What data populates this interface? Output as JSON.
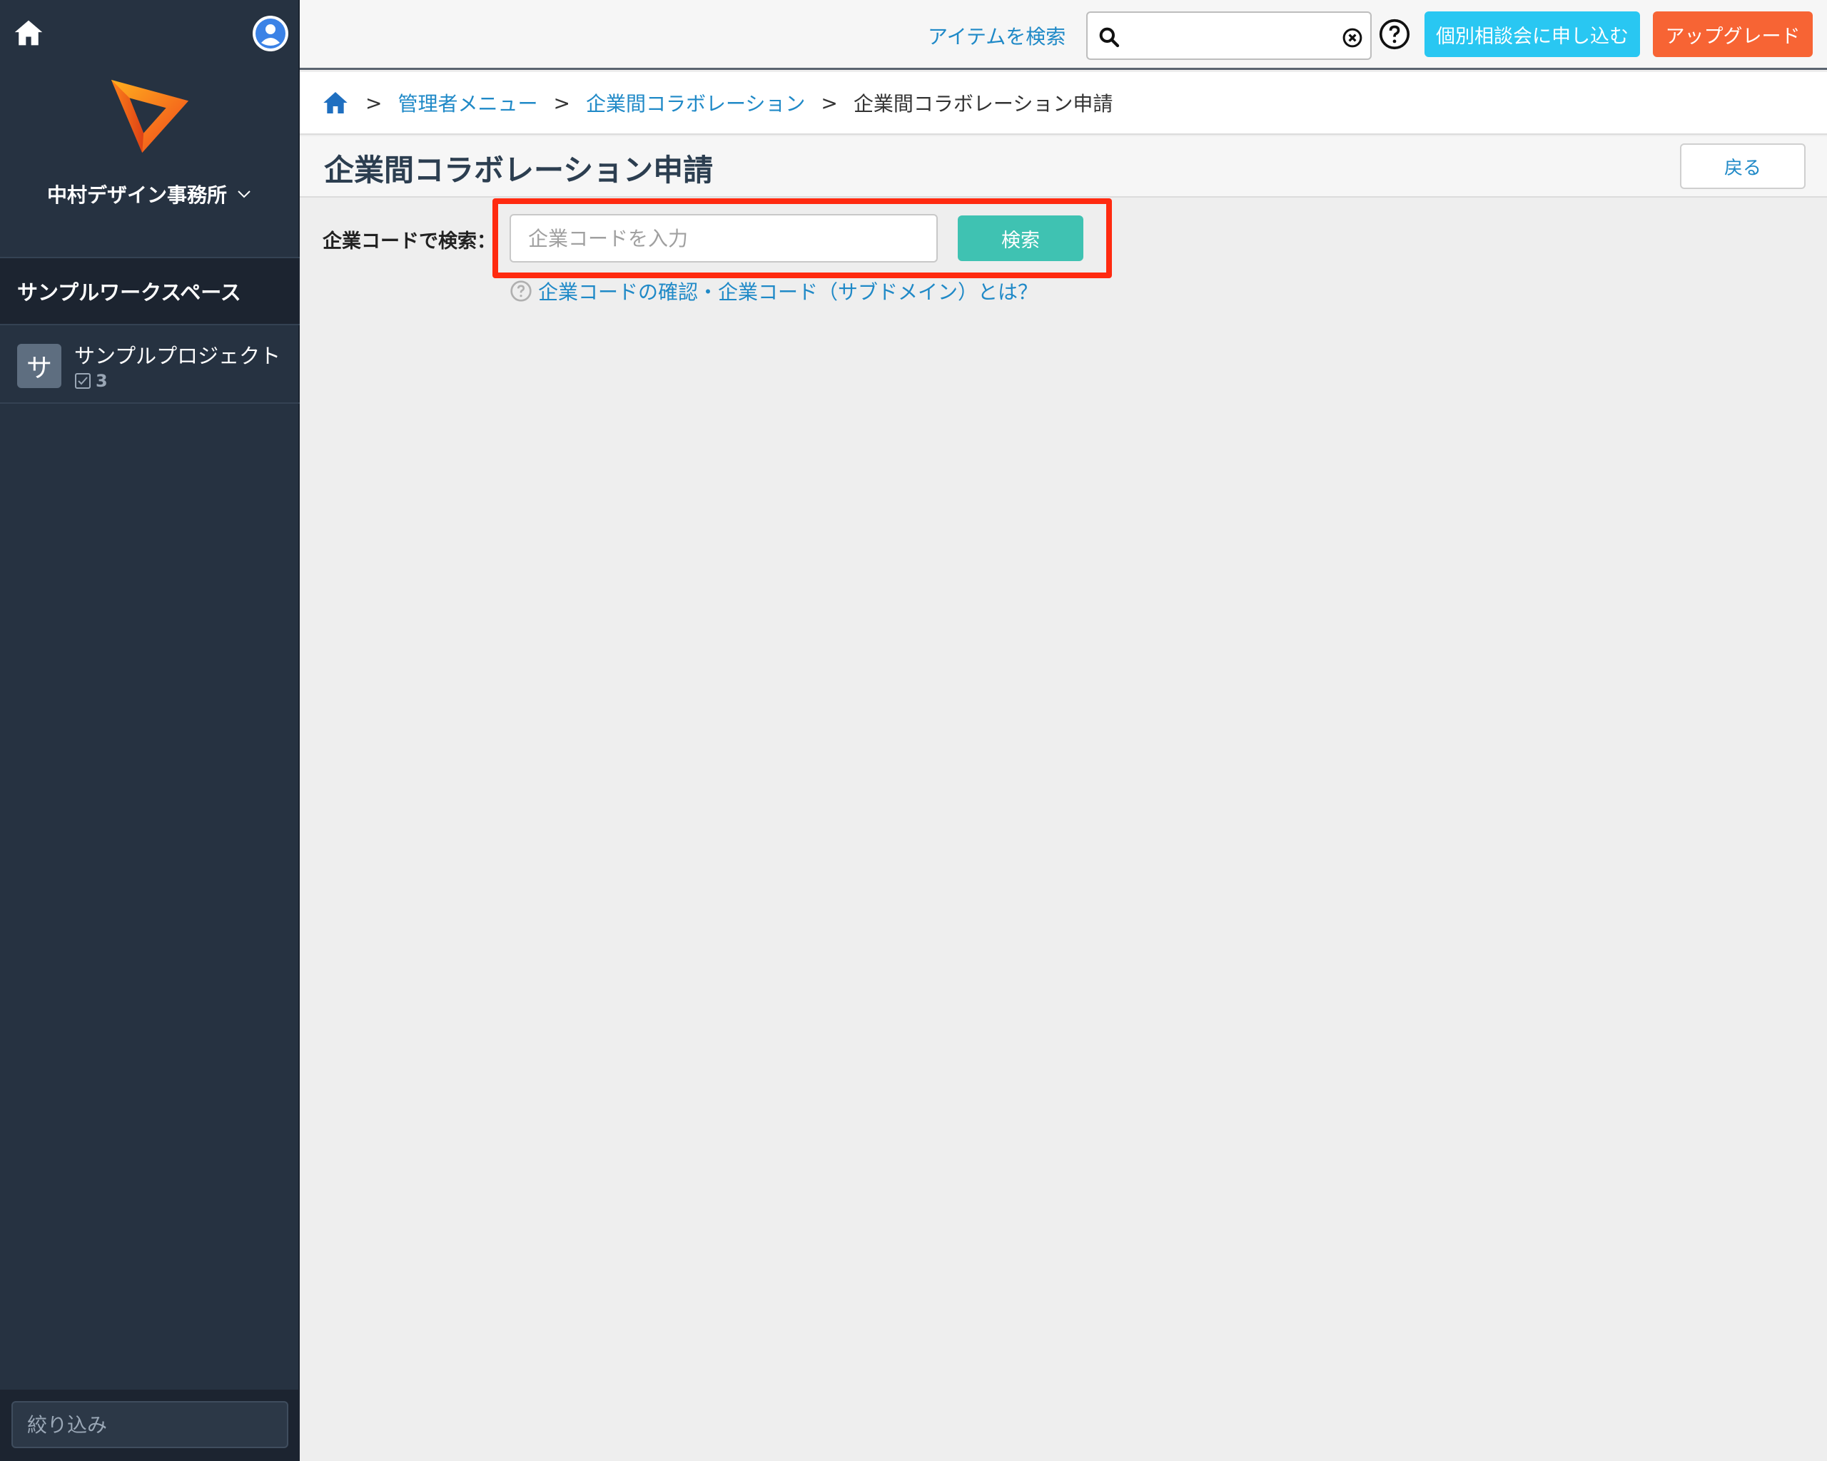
{
  "sidebar": {
    "org_name": "中村デザイン事務所",
    "workspace": "サンプルワークスペース",
    "project": {
      "badge": "サ",
      "name": "サンプルプロジェクト",
      "task_count": "3"
    },
    "filter_placeholder": "絞り込み"
  },
  "header": {
    "search_label": "アイテムを検索",
    "search_value": "",
    "consult_button": "個別相談会に申し込む",
    "upgrade_button": "アップグレード"
  },
  "breadcrumb": {
    "separator": ">",
    "items": [
      "管理者メニュー",
      "企業間コラボレーション"
    ],
    "current": "企業間コラボレーション申請"
  },
  "page": {
    "title": "企業間コラボレーション申請",
    "back_button": "戻る",
    "search_label": "企業コードで検索：",
    "input_placeholder": "企業コードを入力",
    "search_button": "検索",
    "help_link": "企業コードの確認・企業コード（サブドメイン）とは？"
  },
  "colors": {
    "sidebar_bg": "#263241",
    "link": "#1f89c7",
    "consult": "#29c7f2",
    "upgrade": "#f76434",
    "search_button": "#3fc2b2",
    "highlight": "#ff2a10"
  },
  "icons": {
    "sidebar_home": "home-icon",
    "avatar": "user-avatar-icon",
    "logo": "play-triangle-logo",
    "search": "magnifier-icon",
    "clear": "clear-circle-icon",
    "help": "question-circle-icon"
  }
}
